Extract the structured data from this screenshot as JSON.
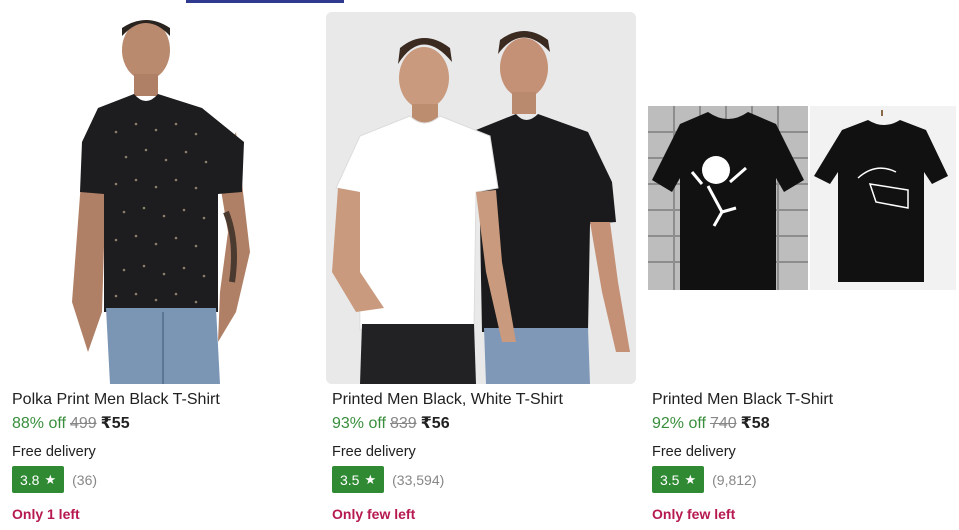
{
  "products": [
    {
      "title": "Polka Print Men Black T-Shirt",
      "discount": "88% off",
      "mrp": "499",
      "price": "₹55",
      "delivery": "Free delivery",
      "rating": "3.8",
      "reviews": "(36)",
      "stock": "Only 1 left"
    },
    {
      "title": "Printed Men Black, White T-Shirt",
      "discount": "93% off",
      "mrp": "839",
      "price": "₹56",
      "delivery": "Free delivery",
      "rating": "3.5",
      "reviews": "(33,594)",
      "stock": "Only few left"
    },
    {
      "title": "Printed Men Black T-Shirt",
      "discount": "92% off",
      "mrp": "740",
      "price": "₹58",
      "delivery": "Free delivery",
      "rating": "3.5",
      "reviews": "(9,812)",
      "stock": "Only few left"
    }
  ],
  "icons": {
    "star": "star-icon"
  },
  "colors": {
    "discount": "#388e3c",
    "rating_badge": "#2f8a33",
    "stock_warning": "#b6184f",
    "tab_indicator": "#2f3a8f"
  }
}
